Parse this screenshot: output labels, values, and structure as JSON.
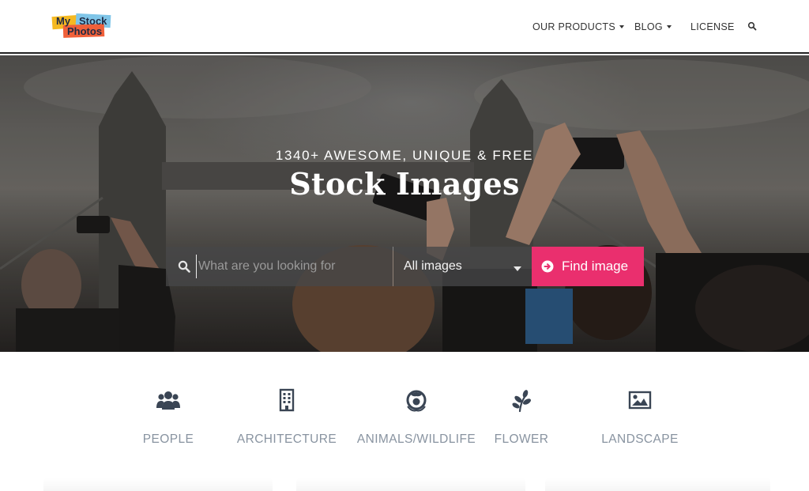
{
  "header": {
    "logo": {
      "word1": "My",
      "word2": "Stock",
      "word3": "Photos"
    },
    "nav": [
      {
        "label": "OUR PRODUCTS",
        "has_dropdown": true
      },
      {
        "label": "BLOG",
        "has_dropdown": true
      },
      {
        "label": "LICENSE",
        "has_dropdown": false
      }
    ],
    "search_icon": "search-icon"
  },
  "hero": {
    "tagline": "1340+ AWESOME, UNIQUE & FREE",
    "headline": "Stock Images",
    "search": {
      "placeholder": "What are you looking for",
      "value": "",
      "icon": "search-icon"
    },
    "filter": {
      "selected": "All images"
    },
    "button": {
      "label": "Find image",
      "icon": "arrow-circle-right-icon",
      "color": "#ea2f6e"
    }
  },
  "categories": [
    {
      "label": "PEOPLE",
      "icon": "people-icon"
    },
    {
      "label": "ARCHITECTURE",
      "icon": "building-icon"
    },
    {
      "label": "ANIMALS/WILDLIFE",
      "icon": "animal-icon"
    },
    {
      "label": "FLOWER",
      "icon": "leaf-icon"
    },
    {
      "label": "LANDSCAPE",
      "icon": "picture-icon"
    }
  ],
  "colors": {
    "accent": "#ea2f6e",
    "category_text": "#8893a0",
    "icon": "#3a4554"
  }
}
